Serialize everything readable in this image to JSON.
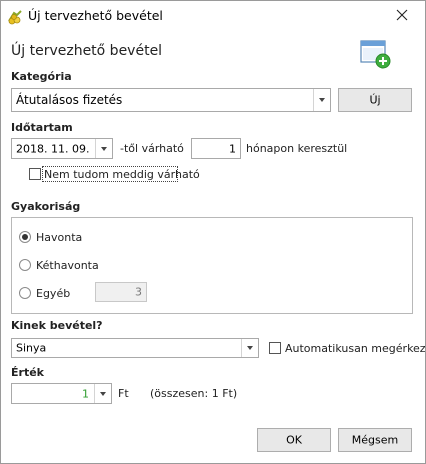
{
  "window": {
    "title": "Új tervezhető bevétel",
    "close_icon": "close-icon",
    "app_icon": "money-coins-icon"
  },
  "header": {
    "title": "Új tervezhető bevétel",
    "icon": "window-add-icon"
  },
  "category": {
    "label": "Kategória",
    "value": "Átutalásos fizetés",
    "new_button": "Új"
  },
  "duration": {
    "label": "Időtartam",
    "date_value": "2018. 11. 09.",
    "from_text": "-től várható",
    "months_value": "1",
    "months_text": "hónapon keresztül",
    "unknown_checkbox_label": "Nem tudom meddig várható",
    "unknown_checked": false
  },
  "frequency": {
    "label": "Gyakoriság",
    "options": [
      "Havonta",
      "Kéthavonta",
      "Egyéb"
    ],
    "selected": "Havonta",
    "other_value": "3"
  },
  "recipient": {
    "label": "Kinek bevétel?",
    "value": "Sinya",
    "auto_checkbox_label": "Automatikusan megérkezik",
    "auto_checked": false
  },
  "amount": {
    "label": "Érték",
    "value": "1",
    "currency": "Ft",
    "total_text": "(összesen: 1 Ft)",
    "value_color": "#2e9c2e"
  },
  "footer": {
    "ok": "OK",
    "cancel": "Mégsem"
  }
}
